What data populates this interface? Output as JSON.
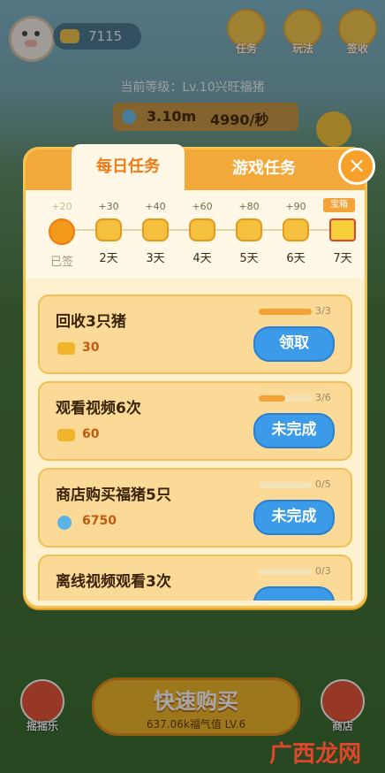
{
  "hud": {
    "coins": "7115",
    "top_buttons": [
      "任务",
      "玩法",
      "签收"
    ],
    "level_text": "当前等级：Lv.10兴旺福猪",
    "speed_amount": "3.10m",
    "speed_rate": "4990/秒"
  },
  "modal": {
    "tabs": [
      "每日任务",
      "游戏任务"
    ],
    "active_tab": "每日任务",
    "close_glyph": "×",
    "signin": {
      "badge": "宝箱",
      "days": [
        {
          "plus": "+20",
          "label": "已签",
          "state": "done"
        },
        {
          "plus": "+30",
          "label": "2天",
          "state": "pending"
        },
        {
          "plus": "+40",
          "label": "3天",
          "state": "pending"
        },
        {
          "plus": "+60",
          "label": "4天",
          "state": "pending"
        },
        {
          "plus": "+80",
          "label": "5天",
          "state": "pending"
        },
        {
          "plus": "+90",
          "label": "6天",
          "state": "pending"
        },
        {
          "plus": "",
          "label": "7天",
          "state": "gift"
        }
      ]
    },
    "tasks": [
      {
        "title": "回收3只猪",
        "reward_icon": "coin-icon",
        "reward": "30",
        "progress_text": "3/3",
        "progress": 1.0,
        "button": "领取"
      },
      {
        "title": "观看视频6次",
        "reward_icon": "coin-icon",
        "reward": "60",
        "progress_text": "3/6",
        "progress": 0.5,
        "button": "未完成"
      },
      {
        "title": "商店购买福猪5只",
        "reward_icon": "gem-icon",
        "reward": "6750",
        "progress_text": "0/5",
        "progress": 0.0,
        "button": "未完成"
      },
      {
        "title": "离线视频观看3次",
        "reward_icon": "coin-icon",
        "reward": "",
        "progress_text": "0/3",
        "progress": 0.0,
        "button": ""
      }
    ]
  },
  "bottom": {
    "buy_title": "快速购买",
    "buy_sub": "637.06k福气值 LV.6",
    "left_label": "摇摇乐",
    "right_label": "商店"
  },
  "watermark": "广西龙网"
}
